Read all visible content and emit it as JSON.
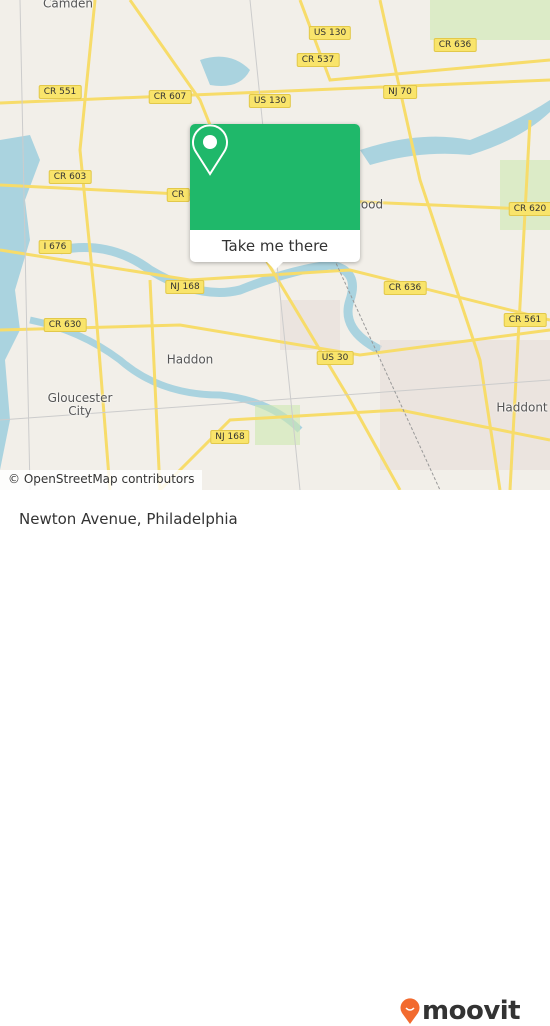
{
  "map": {
    "colors": {
      "land": "#f2efe9",
      "water": "#aad3df",
      "road": "#f7dc6a",
      "park": "#cde8b0",
      "accent": "#1fb86a",
      "brand": "#f26a2e"
    },
    "shields": [
      {
        "label": "CR 537"
      },
      {
        "label": "US 130"
      },
      {
        "label": "CR 636"
      },
      {
        "label": "CR 551"
      },
      {
        "label": "CR 607"
      },
      {
        "label": "US 130"
      },
      {
        "label": "NJ 70"
      },
      {
        "label": "CR 603"
      },
      {
        "label": "CR"
      },
      {
        "label": "CR 620"
      },
      {
        "label": "I 676"
      },
      {
        "label": "NJ 168"
      },
      {
        "label": "CR 636"
      },
      {
        "label": "CR 561"
      },
      {
        "label": "CR 630"
      },
      {
        "label": "US 30"
      },
      {
        "label": "NJ 168"
      }
    ],
    "places": [
      {
        "label": "Camden"
      },
      {
        "label": "ood"
      },
      {
        "label": "Haddon"
      },
      {
        "label": "Gloucester City"
      },
      {
        "label": "Haddont"
      }
    ],
    "attribution": "© OpenStreetMap contributors"
  },
  "popup": {
    "icon": "location-pin-icon",
    "button_label": "Take me there"
  },
  "footer": {
    "title": "Newton Avenue, Philadelphia",
    "logo_text": "moovit"
  }
}
